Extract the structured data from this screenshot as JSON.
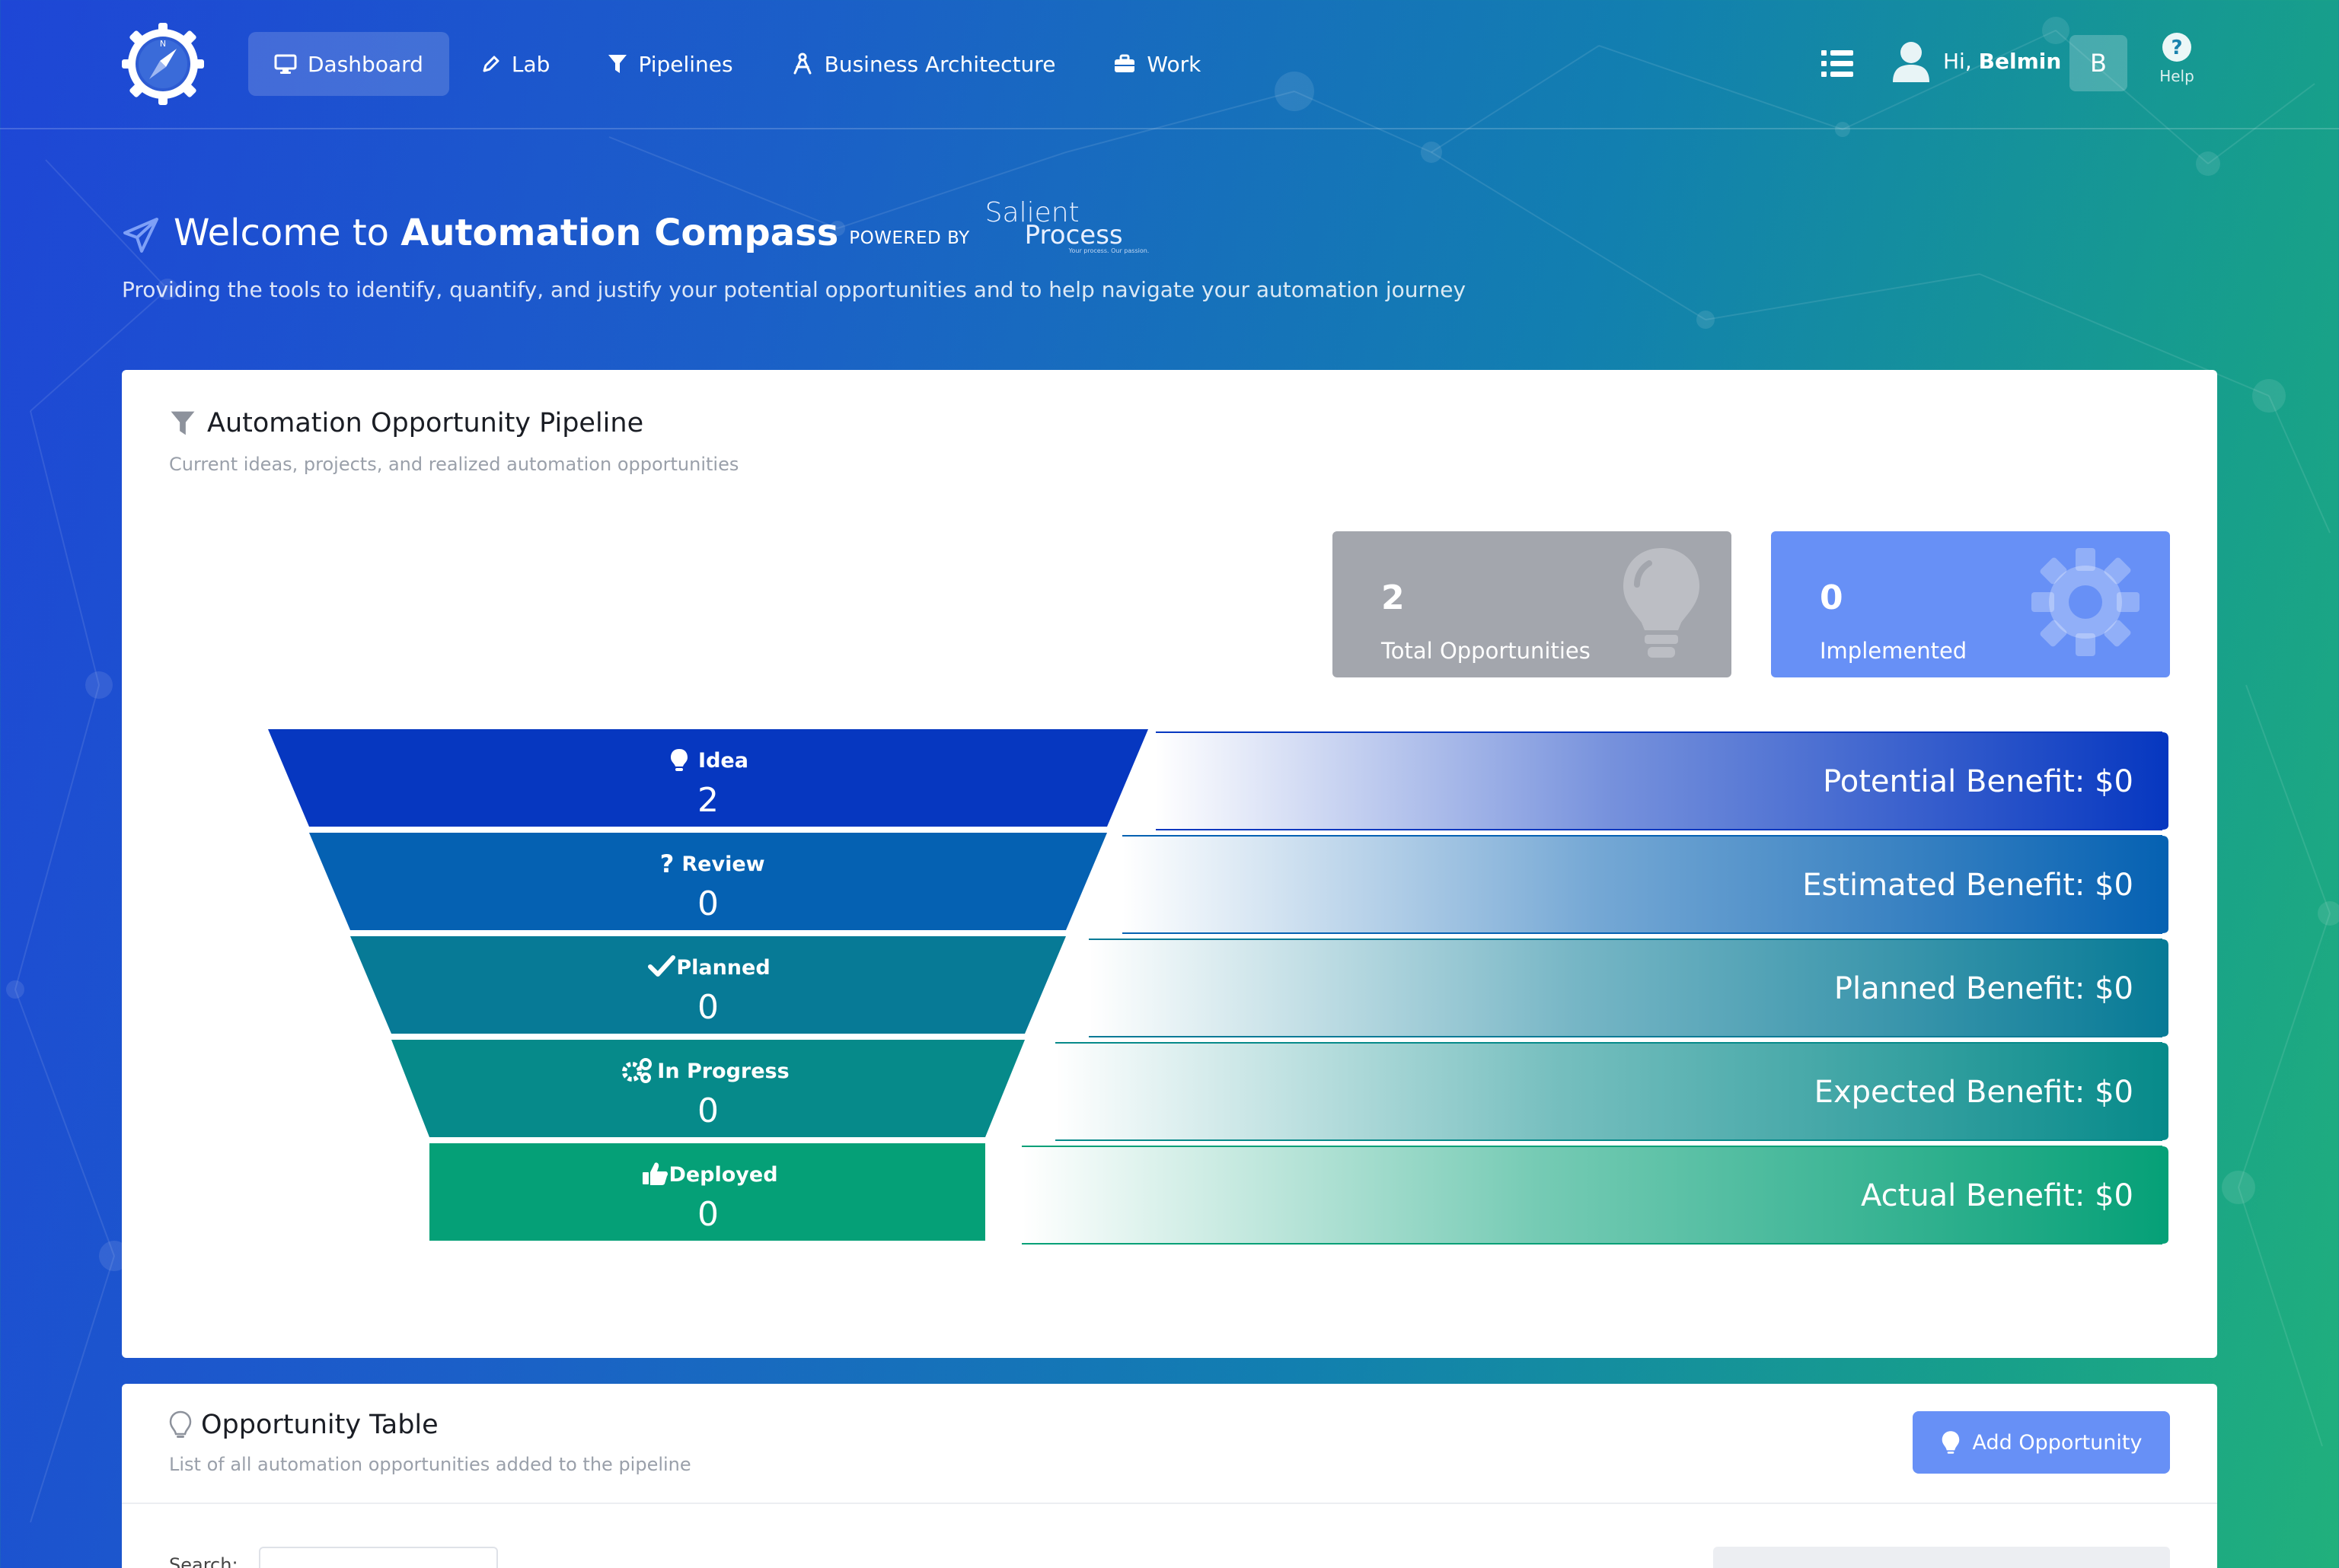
{
  "nav": {
    "items": [
      {
        "label": "Dashboard",
        "icon": "monitor-icon",
        "active": true
      },
      {
        "label": "Lab",
        "icon": "pen-icon",
        "active": false
      },
      {
        "label": "Pipelines",
        "icon": "funnel-icon",
        "active": false
      },
      {
        "label": "Business Architecture",
        "icon": "compass-drafting-icon",
        "active": false
      },
      {
        "label": "Work",
        "icon": "briefcase-icon",
        "active": false
      }
    ],
    "greeting_prefix": "Hi,",
    "user_name": "Belmin",
    "avatar_initial": "B",
    "help_label": "Help"
  },
  "header": {
    "title_prefix": "Welcome to",
    "title_brand": "Automation Compass",
    "powered_by": "POWERED BY",
    "partner_line1": "Salient",
    "partner_line2": "Process",
    "partner_tagline": "Your process. Our passion.",
    "subtitle": "Providing the tools to identify, quantify, and justify your potential opportunities and to help navigate your automation journey"
  },
  "pipeline": {
    "title": "Automation Opportunity Pipeline",
    "subtitle": "Current ideas, projects, and realized automation opportunities",
    "stats": {
      "total_value": "2",
      "total_label": "Total Opportunities",
      "implemented_value": "0",
      "implemented_label": "Implemented"
    },
    "stages": [
      {
        "label": "Idea",
        "count": "2",
        "icon": "lightbulb-icon",
        "color": "#0637c0",
        "benefit": "Potential Benefit: $0"
      },
      {
        "label": "Review",
        "count": "0",
        "icon": "question-icon",
        "color": "#0561b2",
        "benefit": "Estimated Benefit: $0"
      },
      {
        "label": "Planned",
        "count": "0",
        "icon": "check-icon",
        "color": "#077a96",
        "benefit": "Planned Benefit: $0"
      },
      {
        "label": "In Progress",
        "count": "0",
        "icon": "gears-icon",
        "color": "#068a8a",
        "benefit": "Expected Benefit: $0"
      },
      {
        "label": "Deployed",
        "count": "0",
        "icon": "thumbs-up-icon",
        "color": "#05a077",
        "benefit": "Actual Benefit: $0"
      }
    ]
  },
  "opportunity_table": {
    "title": "Opportunity Table",
    "subtitle": "List of all automation opportunities added to the pipeline",
    "add_button": "Add Opportunity",
    "search_label": "Search:"
  }
}
